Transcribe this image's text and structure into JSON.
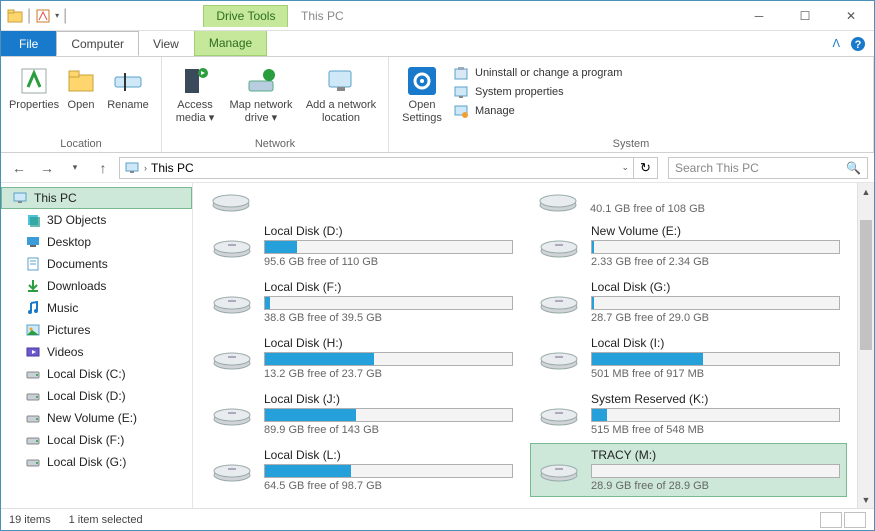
{
  "titlebar": {
    "drive_tools": "Drive Tools",
    "heading": "This PC"
  },
  "menu": {
    "file": "File",
    "computer": "Computer",
    "view": "View",
    "manage": "Manage"
  },
  "ribbon": {
    "location": {
      "properties": "Properties",
      "open": "Open",
      "rename": "Rename",
      "group": "Location"
    },
    "network": {
      "access_media": "Access media",
      "map_drive": "Map network drive",
      "add_location": "Add a network location",
      "group": "Network"
    },
    "settings": {
      "open_settings": "Open Settings"
    },
    "system": {
      "uninstall": "Uninstall or change a program",
      "sysprops": "System properties",
      "manage": "Manage",
      "group": "System"
    }
  },
  "address": {
    "path": "This PC",
    "search_placeholder": "Search This PC"
  },
  "nav": [
    {
      "label": "This PC",
      "icon": "pc",
      "root": true,
      "selected": true
    },
    {
      "label": "3D Objects",
      "icon": "3d"
    },
    {
      "label": "Desktop",
      "icon": "desktop"
    },
    {
      "label": "Documents",
      "icon": "docs"
    },
    {
      "label": "Downloads",
      "icon": "downloads"
    },
    {
      "label": "Music",
      "icon": "music"
    },
    {
      "label": "Pictures",
      "icon": "pictures"
    },
    {
      "label": "Videos",
      "icon": "videos"
    },
    {
      "label": "Local Disk (C:)",
      "icon": "disk"
    },
    {
      "label": "Local Disk (D:)",
      "icon": "disk"
    },
    {
      "label": "New Volume (E:)",
      "icon": "disk"
    },
    {
      "label": "Local Disk (F:)",
      "icon": "disk"
    },
    {
      "label": "Local Disk (G:)",
      "icon": "disk"
    }
  ],
  "partial_free": "40.1 GB free of 108 GB",
  "drives": [
    {
      "name": "Local Disk (D:)",
      "free": "95.6 GB free of 110 GB",
      "pct": 13
    },
    {
      "name": "New Volume (E:)",
      "free": "2.33 GB free of 2.34 GB",
      "pct": 1
    },
    {
      "name": "Local Disk (F:)",
      "free": "38.8 GB free of 39.5 GB",
      "pct": 2
    },
    {
      "name": "Local Disk (G:)",
      "free": "28.7 GB free of 29.0 GB",
      "pct": 1
    },
    {
      "name": "Local Disk (H:)",
      "free": "13.2 GB free of 23.7 GB",
      "pct": 44
    },
    {
      "name": "Local Disk (I:)",
      "free": "501 MB free of 917 MB",
      "pct": 45
    },
    {
      "name": "Local Disk (J:)",
      "free": "89.9 GB free of 143 GB",
      "pct": 37
    },
    {
      "name": "System Reserved (K:)",
      "free": "515 MB free of 548 MB",
      "pct": 6
    },
    {
      "name": "Local Disk (L:)",
      "free": "64.5 GB free of 98.7 GB",
      "pct": 35
    },
    {
      "name": "TRACY (M:)",
      "free": "28.9 GB free of 28.9 GB",
      "pct": 0,
      "selected": true
    }
  ],
  "status": {
    "items": "19 items",
    "selected": "1 item selected"
  }
}
